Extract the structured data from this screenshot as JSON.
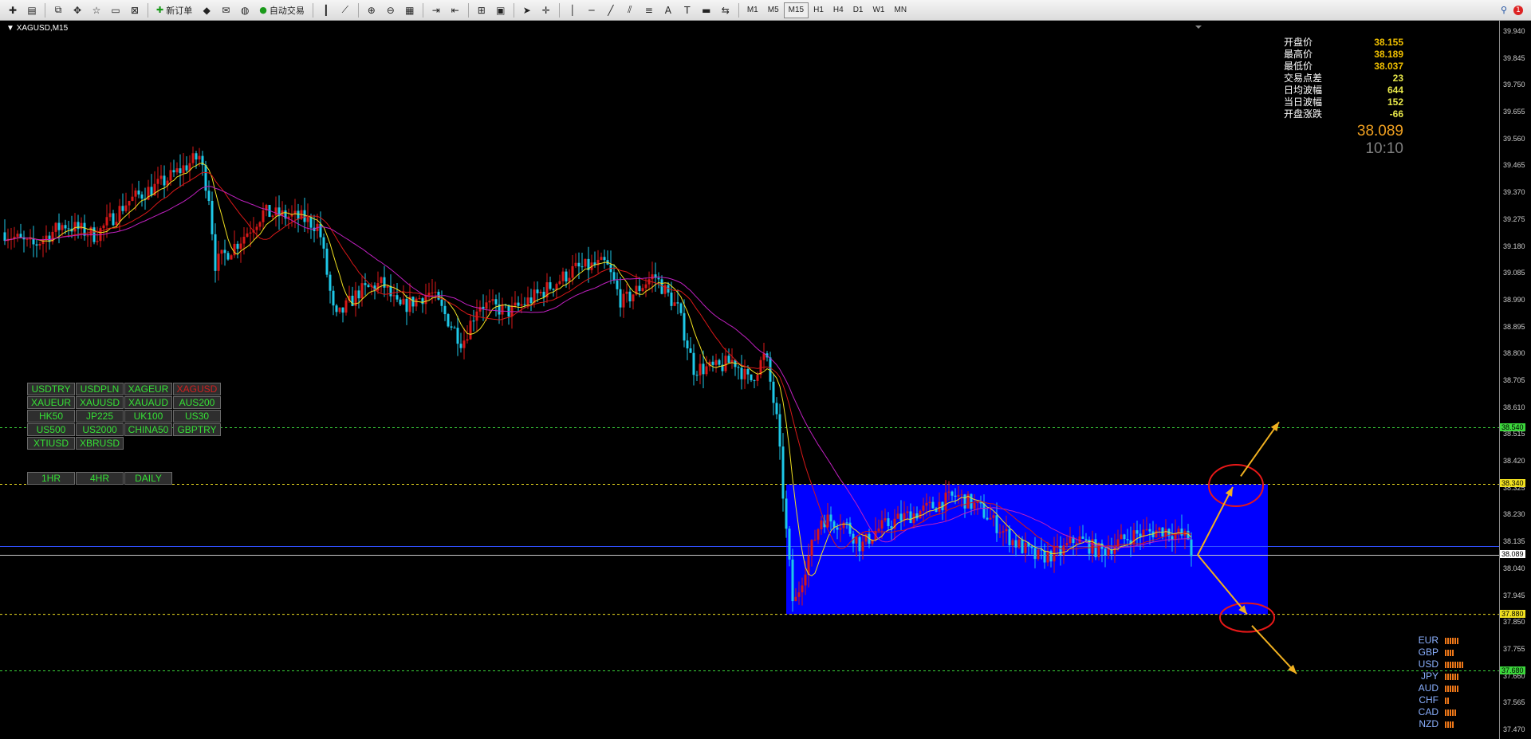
{
  "toolbar": {
    "new_order": "新订单",
    "auto_trading": "自动交易",
    "timeframes": [
      "M1",
      "M5",
      "M15",
      "H1",
      "H4",
      "D1",
      "W1",
      "MN"
    ],
    "active_timeframe": "M15",
    "alert_count": "1"
  },
  "chart": {
    "title": "XAGUSD,M15",
    "info": [
      {
        "label": "开盘价",
        "value": "38.155"
      },
      {
        "label": "最高价",
        "value": "38.189"
      },
      {
        "label": "最低价",
        "value": "38.037"
      },
      {
        "label": "交易点差",
        "value": "23"
      },
      {
        "label": "日均波幅",
        "value": "644"
      },
      {
        "label": "当日波幅",
        "value": "152"
      },
      {
        "label": "开盘涨跌",
        "value": "-66"
      }
    ],
    "current_price": "38.089",
    "time": "10:10",
    "price_axis": [
      "39.940",
      "39.845",
      "39.750",
      "39.655",
      "39.560",
      "39.465",
      "39.370",
      "39.275",
      "39.180",
      "39.085",
      "38.990",
      "38.895",
      "38.800",
      "38.705",
      "38.610",
      "38.515",
      "38.420",
      "38.325",
      "38.230",
      "38.135",
      "38.040",
      "37.945",
      "37.850",
      "37.755",
      "37.660",
      "37.565",
      "37.470"
    ],
    "levels": [
      {
        "value": "38.540",
        "color": "#3cd63c"
      },
      {
        "value": "38.340",
        "color": "#f0e020"
      },
      {
        "value": "38.089",
        "color": "#ffffff"
      },
      {
        "value": "37.880",
        "color": "#f0e020"
      },
      {
        "value": "37.680",
        "color": "#3cd63c"
      }
    ],
    "colors": {
      "bull": "#d81818",
      "bear": "#1ec8e8",
      "box": "#0000ff",
      "ma_fast": "#f0e020",
      "ma_mid": "#d81818",
      "ma_slow": "#c020c0",
      "arrow": "#f0b020"
    }
  },
  "symbols": [
    "USDTRY",
    "USDPLN",
    "XAGEUR",
    "XAGUSD",
    "XAUEUR",
    "XAUUSD",
    "XAUAUD",
    "AUS200",
    "HK50",
    "JP225",
    "UK100",
    "US30",
    "US500",
    "US2000",
    "CHINA50",
    "GBPTRY",
    "XTIUSD",
    "XBRUSD"
  ],
  "selected_symbol": "XAGUSD",
  "period_buttons": [
    "1HR",
    "4HR",
    "DAILY"
  ],
  "currencies": [
    {
      "name": "EUR",
      "strength": 6
    },
    {
      "name": "GBP",
      "strength": 4
    },
    {
      "name": "USD",
      "strength": 8
    },
    {
      "name": "JPY",
      "strength": 6
    },
    {
      "name": "AUD",
      "strength": 6
    },
    {
      "name": "CHF",
      "strength": 2
    },
    {
      "name": "CAD",
      "strength": 5
    },
    {
      "name": "NZD",
      "strength": 4
    }
  ]
}
